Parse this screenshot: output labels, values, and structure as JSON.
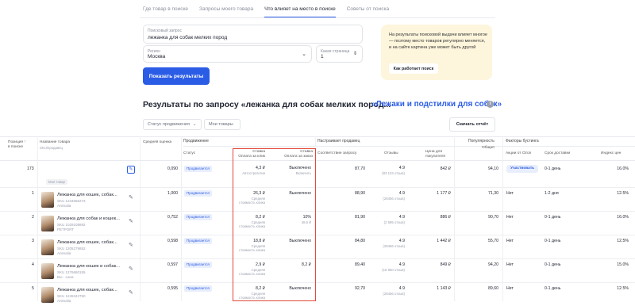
{
  "tabs": [
    "Где товар в поиске",
    "Запросы моего товара",
    "Что влияет на место в поиске",
    "Советы от поиска"
  ],
  "search": {
    "query_label": "Поисковый запрос",
    "query_value": "лежанка для собак мелких пород",
    "region_label": "Регион",
    "region_value": "Москва",
    "page_label": "Какая страница",
    "page_value": "1",
    "submit_label": "Показать результаты"
  },
  "info": {
    "text": "На результаты поисковой выдачи влияет многое — поэтому место товаров регулярно меняется, и на сайте картина уже может быть другой",
    "button": "Как работает поиск"
  },
  "results": {
    "title": "Результаты по запросу «лежанка для собак мелких пород...",
    "category": "«Лежаки и подстилки для собак»",
    "filter_status": "Статус продвижения",
    "filter_my": "Мои товары",
    "download": "Скачать отчёт"
  },
  "table": {
    "groups": {
      "promotion": "Продвижение",
      "settings": "Настраивает продавец",
      "popularity": "Популярность",
      "boost": "Факторы бустинга"
    },
    "headers": {
      "position": "Позиция ↑\nв поиске",
      "name": "Название товара",
      "name_sub": "SKU/продавец",
      "avg_rate": "Средняя оценка",
      "status": "Статус",
      "bid_view": "Ставка\nОплата за клик",
      "bid_order": "Ставка\nОплата за заказ",
      "relevance": "Соответствие запросу",
      "reviews": "Отзывы",
      "price": "Цена для\nпокупателя",
      "popularity_total": "Общая",
      "ozon_promo": "Акции от Ozon",
      "delivery": "Срок доставки",
      "index": "Индекс цен"
    },
    "rows": [
      {
        "pos": "173",
        "name": "",
        "sku": "",
        "seller": "Моя товар",
        "rate": "0,090",
        "status": "Продвигается",
        "bid_view": "4,3 ₽",
        "bid_view_sub": "Автостратегия",
        "bid_order": "Выключено",
        "bid_order_sub": "Включить",
        "relevance": "87,70",
        "reviews": "4.9",
        "reviews_sub": "(83 123 отзыв)",
        "price": "842 ₽",
        "pop": "94,10",
        "promo": "Участвовать",
        "delivery": "0-1 день",
        "index": "16.0%"
      },
      {
        "pos": "1",
        "name": "Лежанка для кошек, собак...",
        "sku": "SKU 1234656273",
        "seller": "Animalia",
        "rate": "1,000",
        "status": "Продвигается",
        "bid_view": "26,3 ₽",
        "bid_view_sub": "Средняя\nстоимость клика",
        "bid_order": "Выключено",
        "bid_order_sub": "",
        "relevance": "88,90",
        "reviews": "4.9",
        "reviews_sub": "(28456 отзыв)",
        "price": "1 177 ₽",
        "pop": "71,30",
        "promo": "Нет",
        "delivery": "1-2 дня",
        "index": "12.5%"
      },
      {
        "pos": "2",
        "name": "Лежанка для собак и кошек...",
        "sku": "SKU 1029108892",
        "seller": "PETPORT",
        "rate": "0,752",
        "status": "Продвигается",
        "bid_view": "8,2 ₽",
        "bid_view_sub": "Средняя\nстоимость клика",
        "bid_order": "10%",
        "bid_order_sub": "48,6 ₽",
        "relevance": "81,90",
        "reviews": "4.9",
        "reviews_sub": "(2 595 отзыв)",
        "price": "886 ₽",
        "pop": "90,70",
        "promo": "Нет",
        "delivery": "0-1 день",
        "index": "16.0%"
      },
      {
        "pos": "3",
        "name": "Лежанка для кошек, собак...",
        "sku": "SKU 1205279852",
        "seller": "Animalia",
        "rate": "0,598",
        "status": "Продвигается",
        "bid_view": "18,8 ₽",
        "bid_view_sub": "Средняя\nстоимость клика",
        "bid_order": "Выключено",
        "bid_order_sub": "",
        "relevance": "84,80",
        "reviews": "4.9",
        "reviews_sub": "(28456 отзыв)",
        "price": "1 442 ₽",
        "pop": "55,70",
        "promo": "Нет",
        "delivery": "0-1 день",
        "index": "12.5%"
      },
      {
        "pos": "4",
        "name": "Лежанка для кошек и собак...",
        "sku": "SKU 1276660155",
        "seller": "Bio - Lana",
        "rate": "0,597",
        "status": "Продвигается",
        "bid_view": "2,9 ₽",
        "bid_view_sub": "Средняя\nстоимость клика",
        "bid_order": "8,2 ₽",
        "bid_order_sub": "",
        "relevance": "89,40",
        "reviews": "4.9",
        "reviews_sub": "(16 960 отзыв)",
        "price": "849 ₽",
        "pop": "94,20",
        "promo": "Нет",
        "delivery": "0-1 день",
        "index": "15.0%"
      },
      {
        "pos": "5",
        "name": "Лежанка для кошек, собак...",
        "sku": "SKU 1245342750",
        "seller": "Animalia",
        "rate": "0,595",
        "status": "Продвигается",
        "bid_view": "8,2 ₽",
        "bid_view_sub": "Средняя\nстоимость клика",
        "bid_order": "Выключено",
        "bid_order_sub": "",
        "relevance": "92,70",
        "reviews": "4.9",
        "reviews_sub": "(28456 отзыв)",
        "price": "1 143 ₽",
        "pop": "89,60",
        "promo": "Нет",
        "delivery": "0-1 день",
        "index": "12.5%"
      }
    ]
  }
}
